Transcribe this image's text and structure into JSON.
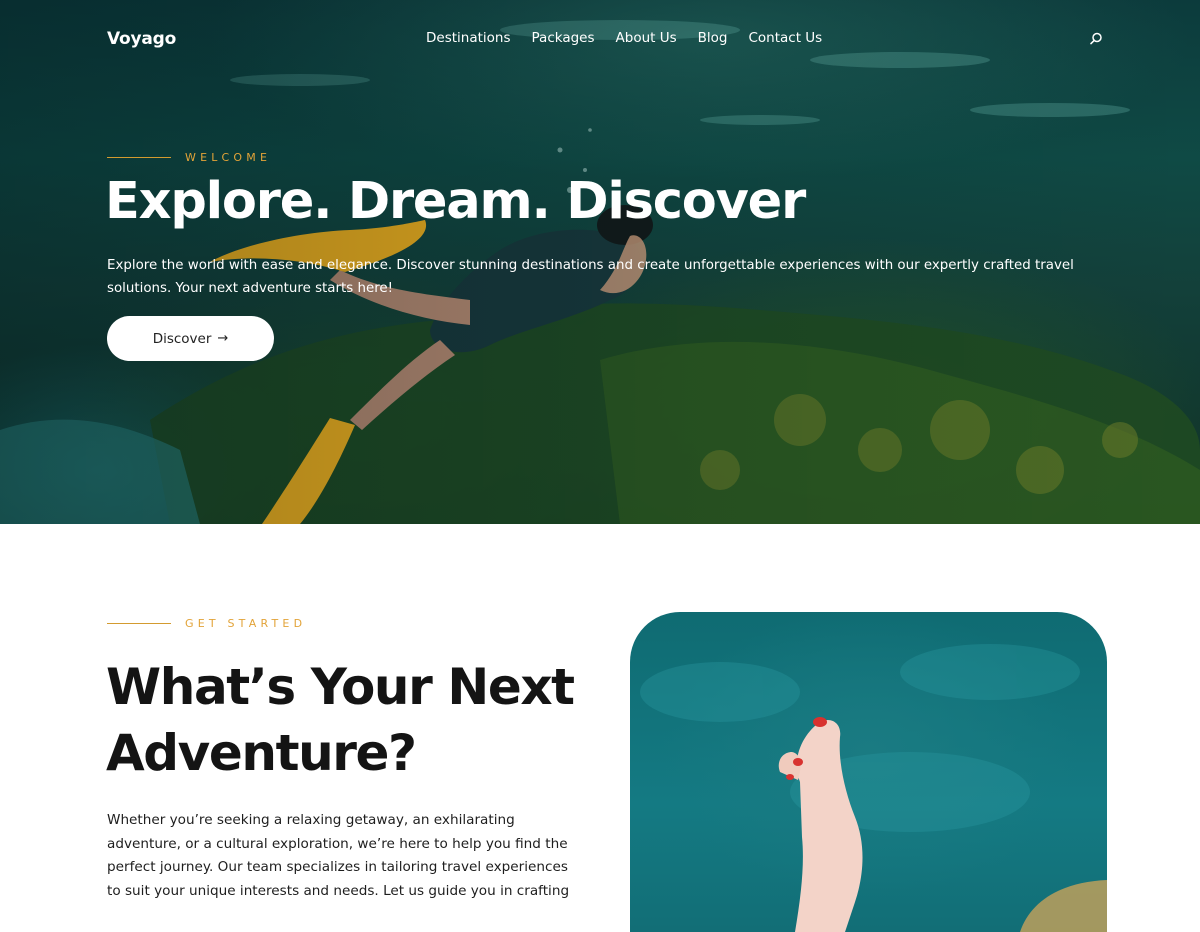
{
  "header": {
    "logo": "Voyago",
    "nav": [
      {
        "label": "Destinations"
      },
      {
        "label": "Packages"
      },
      {
        "label": "About Us"
      },
      {
        "label": "Blog"
      },
      {
        "label": "Contact Us"
      }
    ],
    "search_icon": "search-icon"
  },
  "hero": {
    "eyebrow": "WELCOME",
    "title": "Explore. Dream. Discover",
    "description": "Explore the world with ease and elegance. Discover stunning destinations and create unforgettable experiences with our expertly crafted travel solutions. Your next adventure starts here!",
    "button_label": "Discover",
    "button_icon": "arrow-right-icon",
    "image": "underwater-snorkeler-photo"
  },
  "about": {
    "eyebrow": "GET STARTED",
    "title": "What’s Your Next Adventure?",
    "text": "Whether you’re seeking a relaxing getaway, an exhilarating adventure, or a cultural exploration, we’re here to help you find the perfect journey. Our team specializes in tailoring travel experiences to suit your unique interests and needs. Let us guide you in crafting",
    "image": "feet-over-turquoise-water-photo"
  },
  "colors": {
    "accent": "#e2a338",
    "text_dark": "#141414",
    "hero_overlay": "#0c3b3c"
  }
}
